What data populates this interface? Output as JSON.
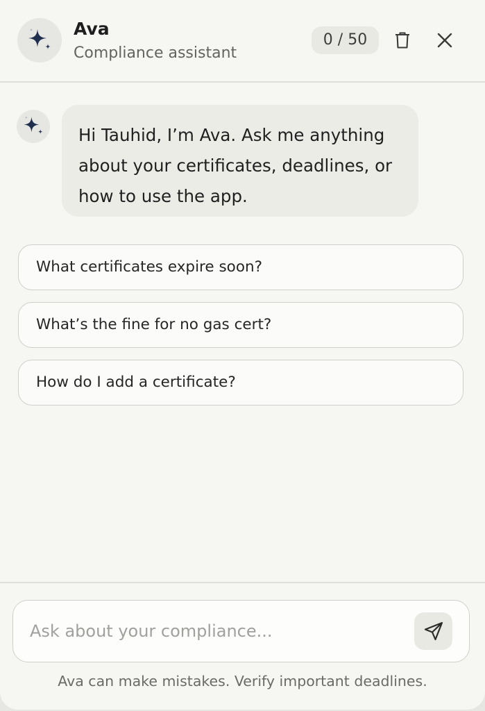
{
  "header": {
    "title": "Ava",
    "subtitle": "Compliance assistant",
    "usage_counter": "0 / 50",
    "icons": {
      "avatar": "sparkle-icon",
      "delete": "trash-icon",
      "close": "close-icon"
    }
  },
  "chat": {
    "messages": [
      {
        "sender": "assistant",
        "lines": [
          "Hi Tauhid, I’m Ava. Ask me anything",
          "about your certificates, deadlines, or",
          "how to use the app."
        ]
      }
    ],
    "suggestions": [
      "What certificates expire soon?",
      "What’s the fine for no gas cert?",
      "How do I add a certificate?"
    ]
  },
  "composer": {
    "placeholder": "Ask about your compliance...",
    "value": "",
    "send_icon": "send-icon"
  },
  "disclaimer": "Ava can make mistakes. Verify important deadlines.",
  "colors": {
    "panel_background": "#f6f6f3",
    "bubble_background": "#ecece7",
    "sparkle": "#1f2f4d",
    "border": "#cfcfca"
  }
}
